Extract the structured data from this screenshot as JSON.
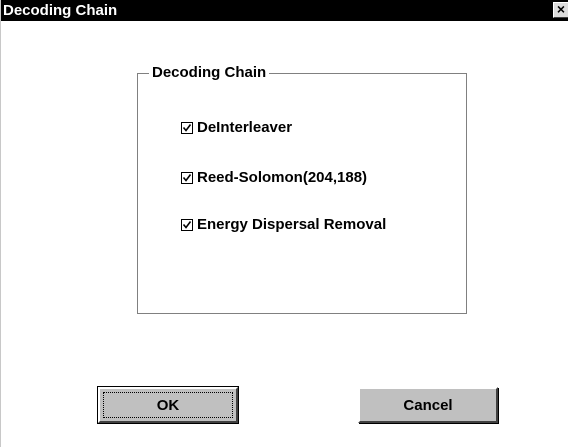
{
  "window": {
    "title": "Decoding Chain",
    "close_glyph": "×",
    "close_icon": "close-icon"
  },
  "group": {
    "label": "Decoding Chain",
    "items": [
      {
        "label": "DeInterleaver",
        "checked": true
      },
      {
        "label": "Reed-Solomon(204,188)",
        "checked": true
      },
      {
        "label": "Energy Dispersal Removal",
        "checked": true
      }
    ]
  },
  "buttons": {
    "ok_label": "OK",
    "cancel_label": "Cancel"
  },
  "colors": {
    "titlebar": "#000000",
    "title_text": "#ffffff",
    "dialog_bg": "#ffffff",
    "button_face": "#c0c0c0",
    "group_border": "#808080"
  }
}
